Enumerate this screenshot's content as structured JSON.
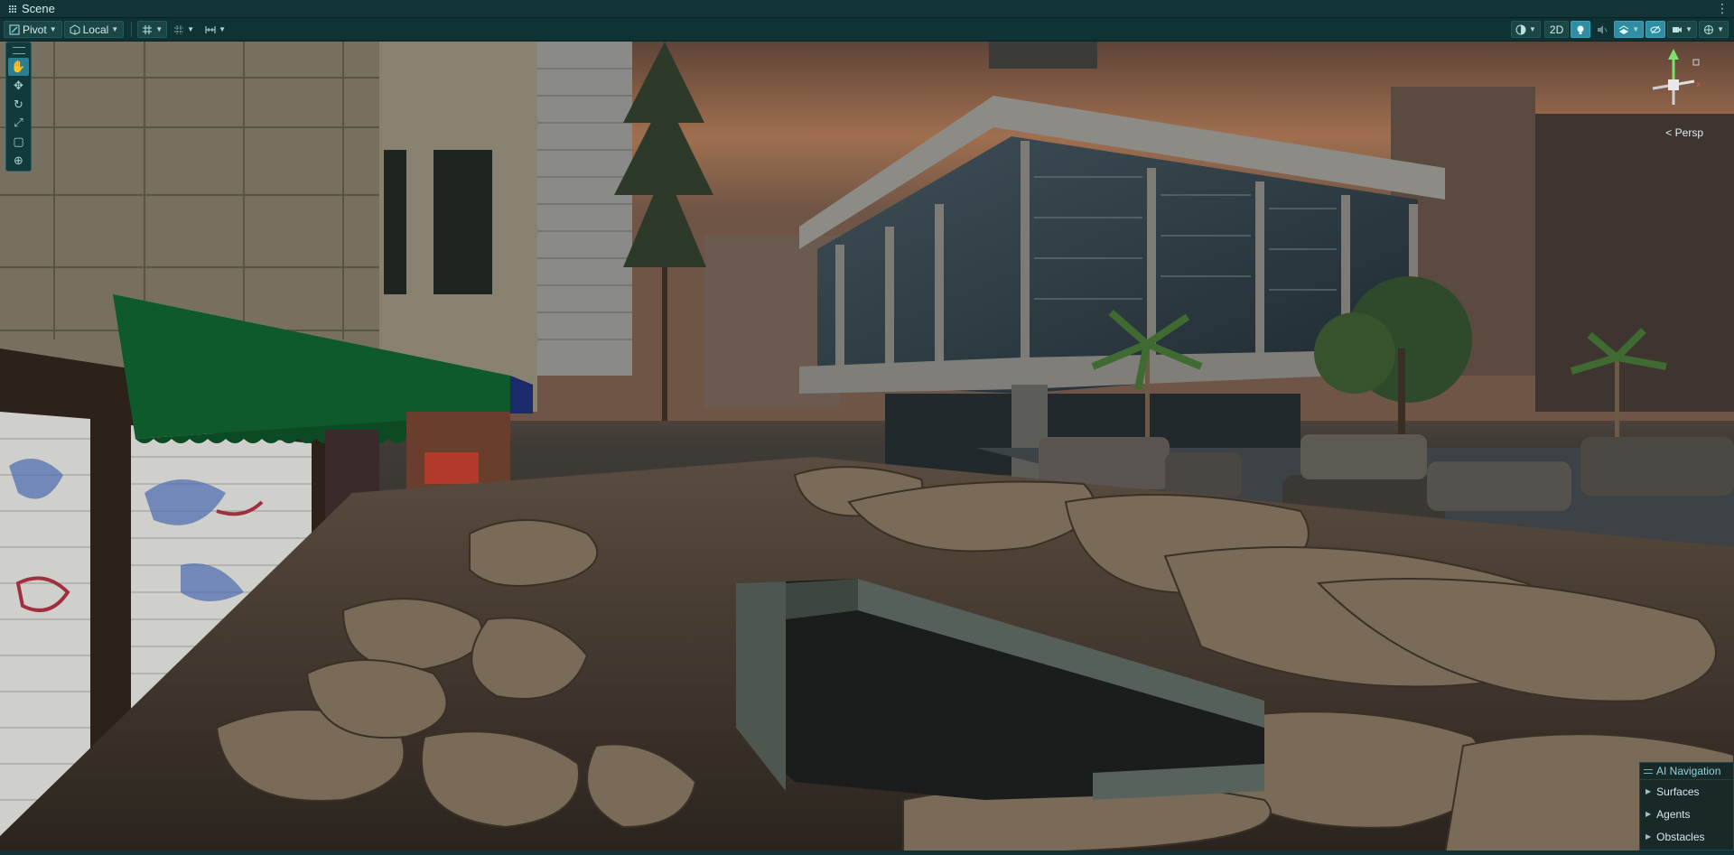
{
  "window": {
    "tab_title": "Scene"
  },
  "toolbar": {
    "pivot_label": "Pivot",
    "space_label": "Local",
    "mode_2d_label": "2D",
    "icons": [
      "pivot-icon",
      "local-icon",
      "grid-snap-icon",
      "increment-snap-icon",
      "ruler-icon",
      "draw-mode-icon",
      "lighting-icon",
      "audio-icon",
      "effects-icon",
      "visibility-icon",
      "camera-icon",
      "gizmos-icon"
    ]
  },
  "tools": {
    "items": [
      {
        "name": "hand-tool",
        "glyph": "✋",
        "active": true
      },
      {
        "name": "move-tool",
        "glyph": "✥",
        "active": false
      },
      {
        "name": "rotate-tool",
        "glyph": "↻",
        "active": false
      },
      {
        "name": "scale-tool",
        "glyph": "⤢",
        "active": false
      },
      {
        "name": "rect-tool",
        "glyph": "▢",
        "active": false
      },
      {
        "name": "transform-tool",
        "glyph": "⊕",
        "active": false
      }
    ]
  },
  "gizmo": {
    "projection_label": "< Persp"
  },
  "ai_navigation": {
    "title": "AI Navigation",
    "items": [
      "Surfaces",
      "Agents",
      "Obstacles"
    ]
  },
  "colors": {
    "accent": "#2f8ea3",
    "panel_bg": "#0f3234",
    "awning_green": "#0f5a2c"
  }
}
